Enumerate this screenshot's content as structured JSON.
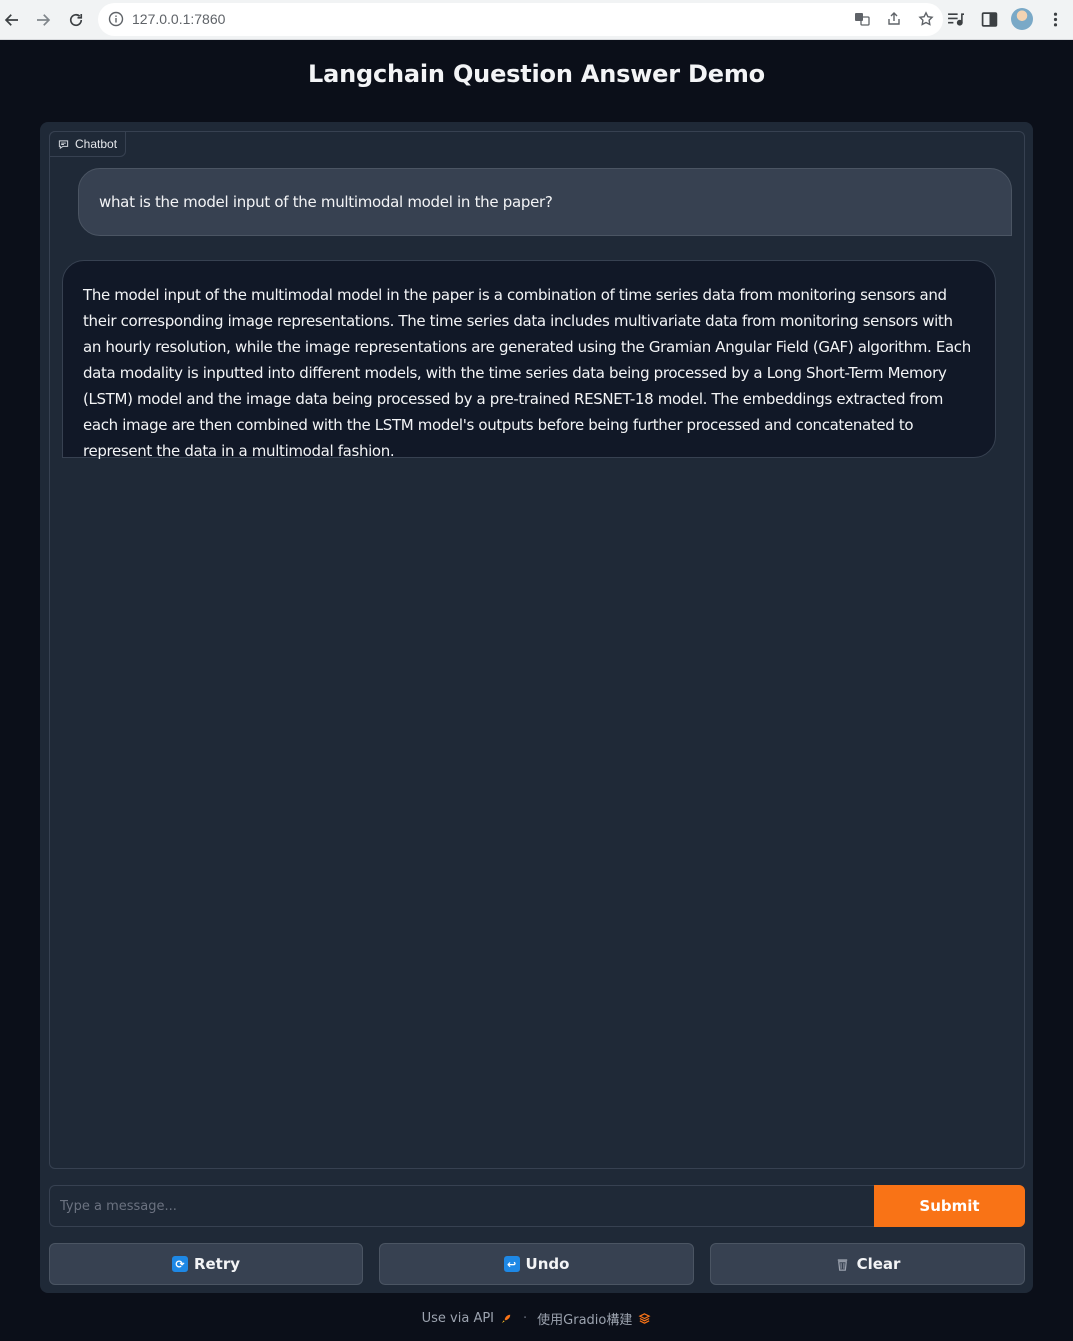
{
  "browser": {
    "url": "127.0.0.1:7860"
  },
  "app": {
    "title": "Langchain Question Answer Demo",
    "chatbot_label": "Chatbot"
  },
  "chat": {
    "user_message": "what is the model input of the multimodal model in the paper?",
    "bot_message": "The model input of the multimodal model in the paper is a combination of time series data from monitoring sensors and their corresponding image representations. The time series data includes multivariate data from monitoring sensors with an hourly resolution, while the image representations are generated using the Gramian Angular Field (GAF) algorithm. Each data modality is inputted into different models, with the time series data being processed by a Long Short-Term Memory (LSTM) model and the image data being processed by a pre-trained RESNET-18 model. The embeddings extracted from each image are then combined with the LSTM model's outputs before being further processed and concatenated to represent the data in a multimodal fashion."
  },
  "input": {
    "placeholder": "Type a message...",
    "value": "",
    "submit_label": "Submit"
  },
  "actions": {
    "retry_label": "Retry",
    "undo_label": "Undo",
    "clear_label": "Clear"
  },
  "footer": {
    "api_link": "Use via API",
    "separator": "·",
    "built_with": "使用Gradio構建"
  },
  "colors": {
    "background": "#0b0f19",
    "panel": "#1f2937",
    "accent": "#f97316"
  }
}
